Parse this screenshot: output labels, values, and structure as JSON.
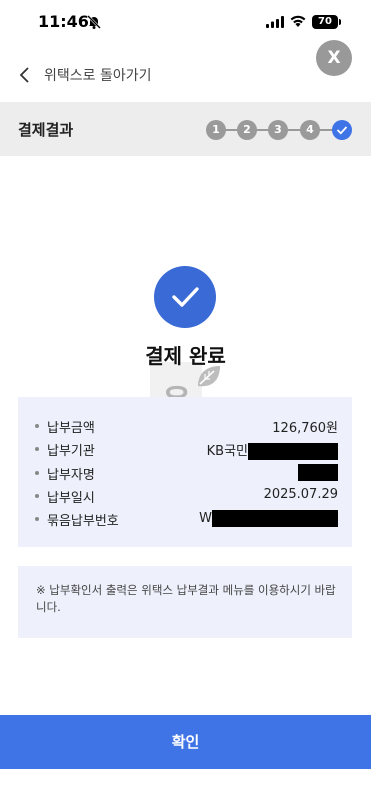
{
  "status_bar": {
    "time": "11:46",
    "battery": "70"
  },
  "close_label": "X",
  "back_label": "위택스로 돌아가기",
  "step_header": {
    "title": "결제결과",
    "steps": [
      "1",
      "2",
      "3",
      "4"
    ]
  },
  "result": {
    "title": "결제 완료"
  },
  "watermark_text": "윤",
  "details": [
    {
      "label": "납부금액",
      "value": "126,760원"
    },
    {
      "label": "납부기관",
      "value": "KB국민"
    },
    {
      "label": "납부자명",
      "value": ""
    },
    {
      "label": "납부일시",
      "value": "2025.07.29"
    },
    {
      "label": "묶음납부번호",
      "value": "W"
    }
  ],
  "notice": "※ 납부확인서 출력은 위택스 납부결과 메뉴를 이용하시기 바랍니다.",
  "confirm_label": "확인",
  "colors": {
    "accent": "#3f74e6",
    "check_circle": "#3a6ad6",
    "step_inactive": "#9a9a9a",
    "detail_bg": "#eef1fc",
    "header_bg": "#ededed"
  }
}
